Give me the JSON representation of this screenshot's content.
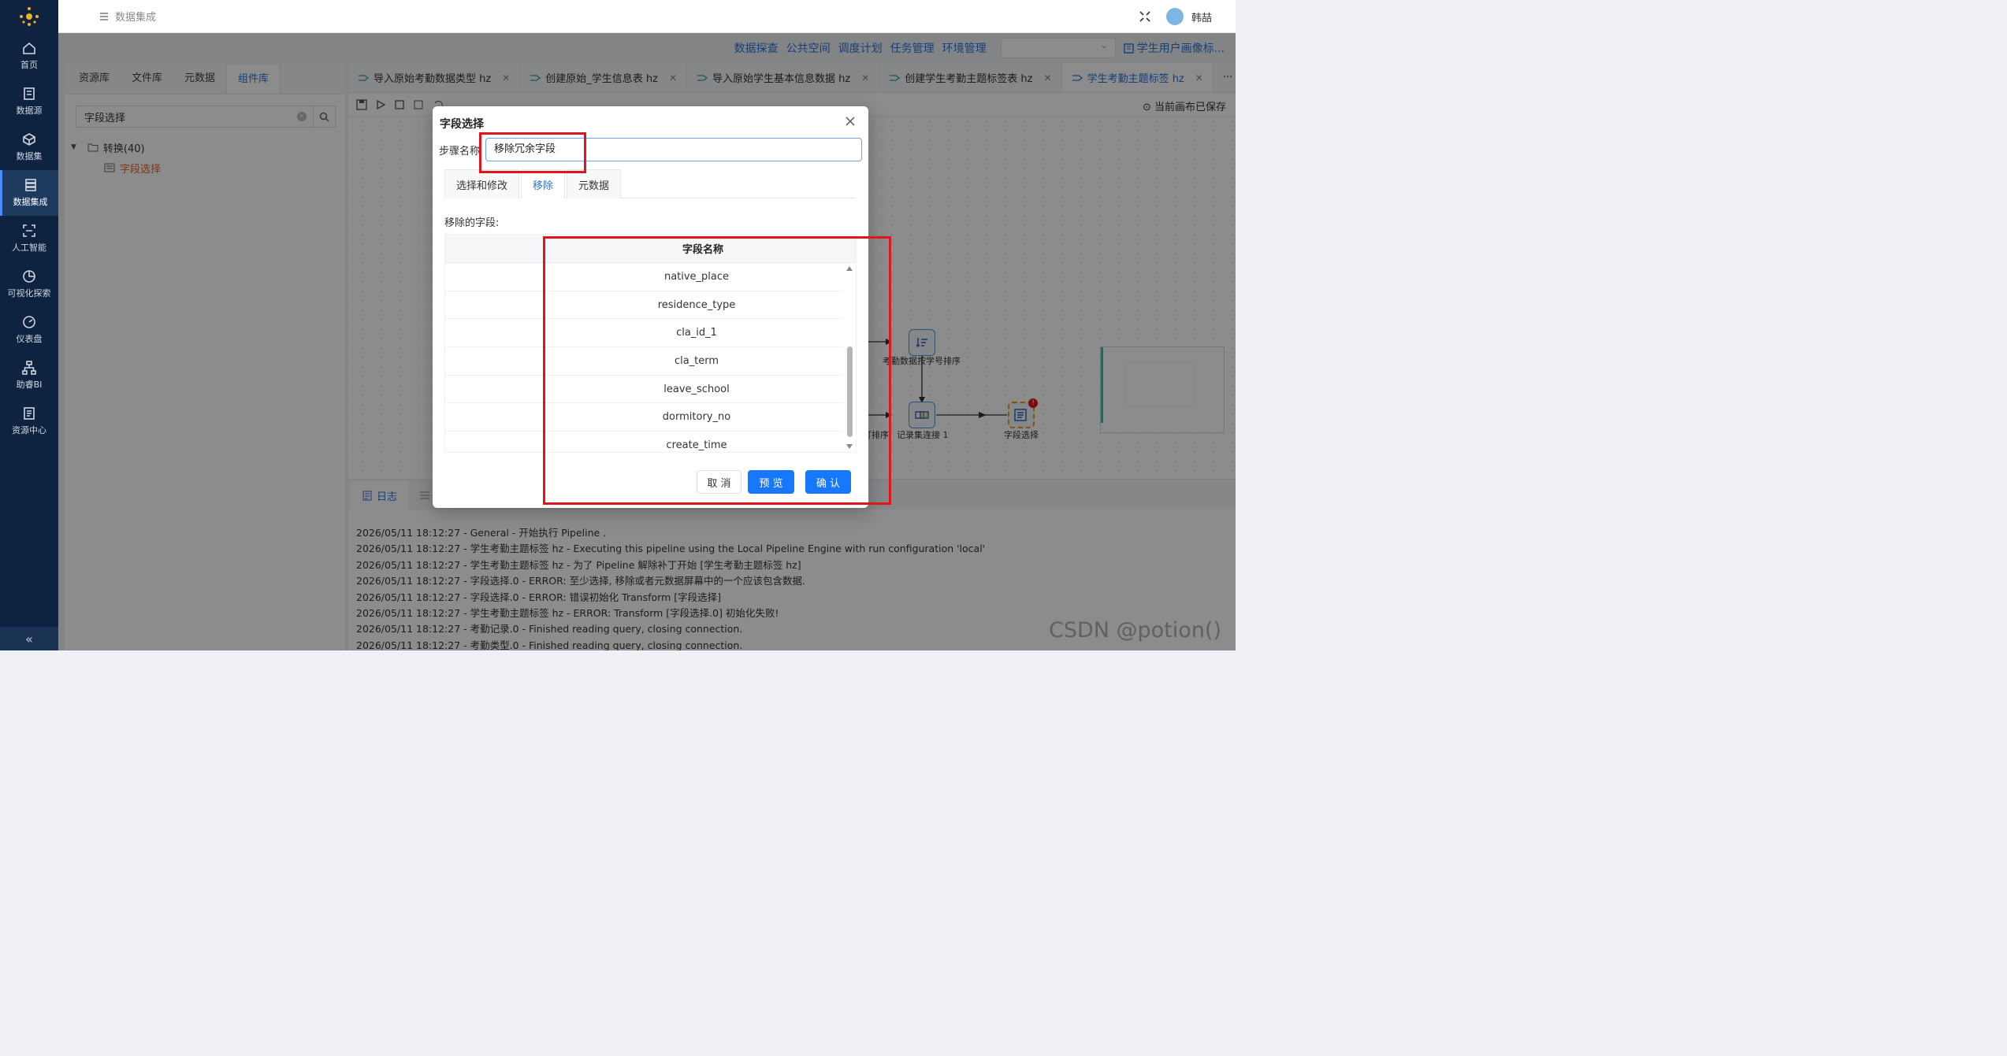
{
  "app": {
    "section": "数据集成",
    "user": "韩喆"
  },
  "sidebar": {
    "items": [
      {
        "label": "首页",
        "icon": "home-icon"
      },
      {
        "label": "数据源",
        "icon": "database-icon"
      },
      {
        "label": "数据集",
        "icon": "cube-icon"
      },
      {
        "label": "数据集成",
        "icon": "server-icon"
      },
      {
        "label": "人工智能",
        "icon": "scan-icon"
      },
      {
        "label": "可视化探索",
        "icon": "pie-icon"
      },
      {
        "label": "仪表盘",
        "icon": "gauge-icon"
      },
      {
        "label": "助睿BI",
        "icon": "org-icon"
      },
      {
        "label": "资源中心",
        "icon": "doc-icon"
      }
    ],
    "active": "数据集成"
  },
  "topmenu": {
    "links": [
      "数据探查",
      "公共空间",
      "调度计划",
      "任务管理",
      "环境管理"
    ],
    "project": "学生用户画像标..."
  },
  "left_panel": {
    "tabs": [
      "资源库",
      "文件库",
      "元数据",
      "组件库"
    ],
    "active_tab": "组件库",
    "search_value": "字段选择",
    "tree_parent": "转换(40)",
    "tree_child": "字段选择"
  },
  "editor_tabs": [
    {
      "label": "导入原始考勤数据类型 hz",
      "active": false
    },
    {
      "label": "创建原始_学生信息表 hz",
      "active": false
    },
    {
      "label": "导入原始学生基本信息数据 hz",
      "active": false
    },
    {
      "label": "创建学生考勤主题标签表 hz",
      "active": false
    },
    {
      "label": "学生考勤主题标签 hz",
      "active": true
    }
  ],
  "more_tabs": "···",
  "toolbar": {
    "saved_status": "当前画布已保存"
  },
  "canvas": {
    "nodes": [
      {
        "label": "考勤数据按学号排序"
      },
      {
        "label": "记录集连接 1"
      },
      {
        "label": "字段选择"
      }
    ],
    "partial_label": "打排序"
  },
  "bottom": {
    "tab_log": "日志",
    "log_lines": [
      "2026/05/11 18:12:27 - General - 开始执行 Pipeline .",
      "2026/05/11 18:12:27 - 学生考勤主题标签 hz - Executing this pipeline using the Local Pipeline Engine with run configuration 'local'",
      "2026/05/11 18:12:27 - 学生考勤主题标签 hz - 为了 Pipeline 解除补丁开始 [学生考勤主题标签 hz]",
      "2026/05/11 18:12:27 - 字段选择.0 - ERROR: 至少选择, 移除或者元数据屏幕中的一个应该包含数据.",
      "2026/05/11 18:12:27 - 字段选择.0 - ERROR: 错误初始化 Transform [字段选择]",
      "2026/05/11 18:12:27 - 学生考勤主题标签 hz - ERROR: Transform [字段选择.0] 初始化失败!",
      "2026/05/11 18:12:27 - 考勤记录.0 - Finished reading query, closing connection.",
      "2026/05/11 18:12:27 - 考勤类型.0 - Finished reading query, closing connection."
    ]
  },
  "dialog": {
    "title": "字段选择",
    "step_label": "步骤名称",
    "step_value": "移除冗余字段",
    "tabs": [
      "选择和修改",
      "移除",
      "元数据"
    ],
    "active_tab": "移除",
    "remove_label": "移除的字段:",
    "column_header": "字段名称",
    "rows": [
      "native_place",
      "residence_type",
      "cla_id_1",
      "cla_term",
      "leave_school",
      "dormitory_no",
      "create_time"
    ],
    "cancel": "取 消",
    "preview": "预 览",
    "confirm": "确 认"
  },
  "watermark": "CSDN @potion()",
  "colors": {
    "sidebar": "#0e2340",
    "accent": "#1677ff",
    "link": "#2a73d9",
    "highlight": "#e0161e",
    "error": "#e0161e"
  }
}
